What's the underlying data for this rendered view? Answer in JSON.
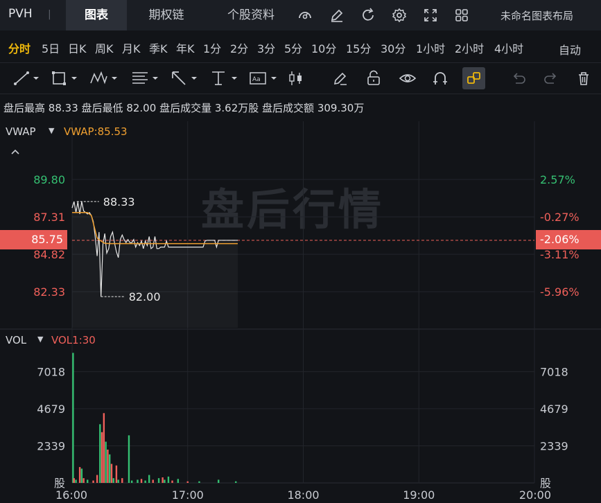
{
  "topbar": {
    "ticker": "PVH",
    "ticker_sep": "|",
    "tabs": [
      {
        "label": "图表",
        "active": true
      },
      {
        "label": "期权链",
        "active": false
      },
      {
        "label": "个股资料",
        "active": false
      }
    ],
    "icons": [
      "gauge-icon",
      "edit-icon",
      "refresh-icon",
      "settings-icon",
      "expand-icon",
      "grid-layout-icon"
    ],
    "layout_name": "未命名图表布局"
  },
  "periods": {
    "items": [
      "分时",
      "5日",
      "日K",
      "周K",
      "月K",
      "季K",
      "年K",
      "1分",
      "2分",
      "3分",
      "5分",
      "10分",
      "15分",
      "30分",
      "1小时",
      "2小时",
      "4小时"
    ],
    "active_index": 0,
    "auto_label": "自动"
  },
  "toolbar": {
    "tools": [
      "trendline-tool",
      "rectangle-tool",
      "pattern-tool",
      "fibonacci-tool",
      "arrow-tool",
      "measure-tool",
      "text-tool",
      "candle-tool",
      "brush-tool",
      "lock-tool",
      "visibility-tool",
      "magnet-tool",
      "link-tool",
      "undo-tool",
      "redo-tool",
      "delete-tool"
    ]
  },
  "stats": {
    "items": [
      {
        "label": "盘后最高",
        "value": "88.33"
      },
      {
        "label": "盘后最低",
        "value": "82.00"
      },
      {
        "label": "盘后成交量",
        "value": "3.62万股"
      },
      {
        "label": "盘后成交额",
        "value": "309.30万"
      }
    ]
  },
  "chart_data": {
    "type": "line",
    "indicator_title": "VWAP",
    "indicator_value": "VWAP:85.53",
    "watermark": "盘后行情",
    "current_price": "85.75",
    "current_pct": "-2.06%",
    "max_label": "88.33",
    "min_label": "82.00",
    "max_value": 88.33,
    "min_value": 82.0,
    "prev_close": 87.54,
    "ylim": [
      81.6,
      91.0
    ],
    "left_ticks": [
      {
        "label": "89.80",
        "value": 89.8,
        "tone": "up"
      },
      {
        "label": "87.31",
        "value": 87.31,
        "tone": "down"
      },
      {
        "label": "84.82",
        "value": 84.82,
        "tone": "down"
      },
      {
        "label": "82.33",
        "value": 82.33,
        "tone": "down"
      }
    ],
    "right_ticks": [
      {
        "label": "2.57%",
        "value": 89.8,
        "tone": "up"
      },
      {
        "label": "-0.27%",
        "value": 87.31,
        "tone": "down"
      },
      {
        "label": "-3.11%",
        "value": 84.82,
        "tone": "down"
      },
      {
        "label": "-5.96%",
        "value": 82.33,
        "tone": "down"
      }
    ],
    "xlim": [
      0,
      240
    ],
    "x_ticks": [
      {
        "label": "16:00",
        "value": 0
      },
      {
        "label": "17:00",
        "value": 60
      },
      {
        "label": "18:00",
        "value": 120
      },
      {
        "label": "19:00",
        "value": 180
      },
      {
        "label": "20:00",
        "value": 240
      }
    ],
    "price_series": {
      "name": "price",
      "x": [
        0,
        1,
        2,
        3,
        4,
        5,
        6,
        7,
        8,
        9,
        10,
        11,
        12,
        13,
        14,
        15,
        16,
        17,
        18,
        19,
        20,
        21,
        22,
        23,
        24,
        25,
        26,
        27,
        28,
        29,
        30,
        31,
        32,
        33,
        34,
        35,
        36,
        37,
        38,
        39,
        40,
        41,
        42,
        43,
        44,
        45,
        46,
        47,
        48,
        49,
        50,
        51,
        52,
        53,
        54,
        55,
        56,
        57,
        58,
        59,
        60,
        61,
        62,
        63,
        64,
        65,
        66,
        67,
        68,
        69,
        70,
        71,
        72,
        73,
        74,
        75,
        76,
        77,
        78,
        79,
        80,
        81,
        82,
        83,
        84,
        85,
        86
      ],
      "values": [
        87.9,
        88.33,
        87.6,
        88.3,
        87.5,
        88.33,
        87.7,
        87.6,
        87.5,
        87.6,
        87.4,
        87.0,
        86.0,
        84.7,
        86.3,
        82.0,
        85.5,
        86.2,
        84.9,
        85.2,
        86.0,
        86.3,
        85.6,
        85.0,
        84.6,
        85.8,
        86.1,
        85.8,
        85.6,
        85.8,
        85.6,
        85.6,
        85.8,
        85.3,
        85.6,
        85.4,
        85.7,
        85.2,
        85.7,
        85.4,
        86.0,
        85.2,
        85.3,
        86.0,
        85.2,
        85.2,
        85.3,
        85.3,
        85.3,
        85.7,
        85.3,
        85.3,
        85.3,
        85.3,
        85.3,
        85.3,
        85.3,
        85.3,
        85.3,
        85.3,
        85.3,
        85.3,
        85.3,
        85.3,
        85.3,
        85.3,
        85.3,
        85.3,
        85.3,
        85.7,
        85.75,
        85.75,
        85.75,
        85.75,
        85.75,
        85.3,
        85.75,
        85.75,
        85.75,
        85.75,
        85.75,
        85.75,
        85.75,
        85.75,
        85.75,
        85.75,
        85.75
      ],
      "color": "#e8e8e8"
    },
    "vwap_series": {
      "name": "VWAP",
      "x": [
        0,
        8,
        10,
        12,
        13,
        15,
        17,
        20,
        86
      ],
      "values": [
        87.6,
        87.6,
        87.4,
        86.4,
        85.9,
        85.7,
        85.55,
        85.53,
        85.53
      ],
      "color": "#f0a030"
    },
    "volume": {
      "indicator_title": "VOL",
      "indicator_value": "VOL1:30",
      "unit_label": "股",
      "ylim": [
        0,
        9000
      ],
      "ticks": [
        {
          "label": "7018",
          "value": 7018
        },
        {
          "label": "4679",
          "value": 4679
        },
        {
          "label": "2339",
          "value": 2339
        }
      ],
      "bars": [
        {
          "x": 0.5,
          "value": 8200,
          "dir": "up"
        },
        {
          "x": 1,
          "value": 300,
          "dir": "down"
        },
        {
          "x": 2,
          "value": 200,
          "dir": "up"
        },
        {
          "x": 4,
          "value": 1000,
          "dir": "down"
        },
        {
          "x": 5,
          "value": 900,
          "dir": "up"
        },
        {
          "x": 6,
          "value": 300,
          "dir": "down"
        },
        {
          "x": 8,
          "value": 200,
          "dir": "up"
        },
        {
          "x": 11,
          "value": 150,
          "dir": "down"
        },
        {
          "x": 13,
          "value": 500,
          "dir": "down"
        },
        {
          "x": 14.5,
          "value": 3700,
          "dir": "up"
        },
        {
          "x": 15.5,
          "value": 3200,
          "dir": "down"
        },
        {
          "x": 16.5,
          "value": 4400,
          "dir": "down"
        },
        {
          "x": 17.5,
          "value": 2600,
          "dir": "up"
        },
        {
          "x": 18.5,
          "value": 2100,
          "dir": "down"
        },
        {
          "x": 19.5,
          "value": 1800,
          "dir": "up"
        },
        {
          "x": 20.5,
          "value": 1200,
          "dir": "down"
        },
        {
          "x": 21.5,
          "value": 300,
          "dir": "up"
        },
        {
          "x": 23,
          "value": 1100,
          "dir": "down"
        },
        {
          "x": 24,
          "value": 200,
          "dir": "up"
        },
        {
          "x": 26,
          "value": 300,
          "dir": "down"
        },
        {
          "x": 29.5,
          "value": 3000,
          "dir": "up"
        },
        {
          "x": 31,
          "value": 150,
          "dir": "up"
        },
        {
          "x": 34,
          "value": 200,
          "dir": "up"
        },
        {
          "x": 36,
          "value": 250,
          "dir": "down"
        },
        {
          "x": 38,
          "value": 150,
          "dir": "up"
        },
        {
          "x": 40,
          "value": 500,
          "dir": "up"
        },
        {
          "x": 42,
          "value": 200,
          "dir": "down"
        },
        {
          "x": 45,
          "value": 300,
          "dir": "up"
        },
        {
          "x": 47,
          "value": 350,
          "dir": "down"
        },
        {
          "x": 48,
          "value": 200,
          "dir": "up"
        },
        {
          "x": 50,
          "value": 400,
          "dir": "up"
        },
        {
          "x": 52,
          "value": 150,
          "dir": "down"
        },
        {
          "x": 55,
          "value": 250,
          "dir": "up"
        },
        {
          "x": 60,
          "value": 100,
          "dir": "down"
        },
        {
          "x": 66,
          "value": 100,
          "dir": "up"
        },
        {
          "x": 76,
          "value": 200,
          "dir": "up"
        },
        {
          "x": 85,
          "value": 100,
          "dir": "up"
        }
      ]
    }
  }
}
